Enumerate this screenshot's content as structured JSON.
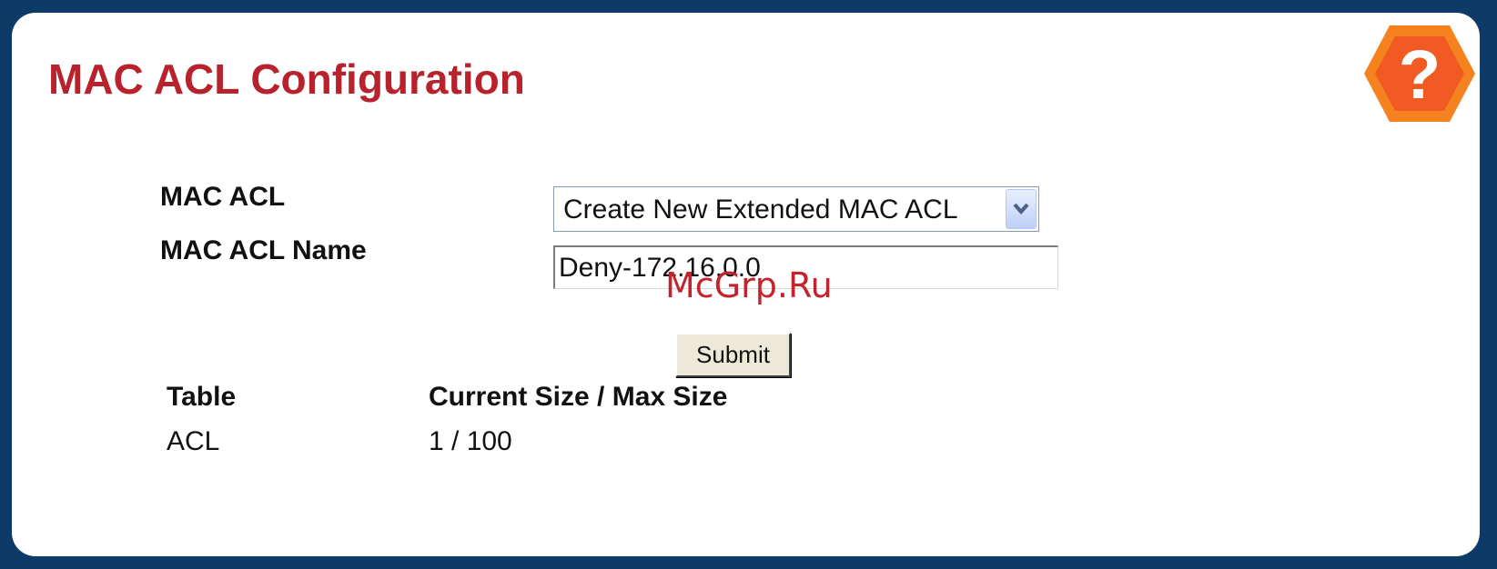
{
  "page": {
    "title": "MAC ACL Configuration"
  },
  "help": {
    "icon": "help-question-icon",
    "glyph": "?",
    "colors": {
      "outer": "#f6821f",
      "inner": "#f15a22",
      "glyph": "#ffffff"
    }
  },
  "form": {
    "mac_acl_label": "MAC ACL",
    "mac_acl_selected": "Create New Extended MAC ACL",
    "mac_acl_name_label": "MAC ACL Name",
    "mac_acl_name_value": "Deny-172.16.0.0",
    "submit_label": "Submit"
  },
  "table": {
    "headers": [
      "Table",
      "Current Size / Max Size"
    ],
    "rows": [
      [
        "ACL",
        "1 / 100"
      ]
    ]
  },
  "watermark": {
    "text": "McGrp.Ru"
  },
  "colors": {
    "background": "#0d3a66",
    "panel": "#ffffff",
    "title": "#b8222d"
  }
}
